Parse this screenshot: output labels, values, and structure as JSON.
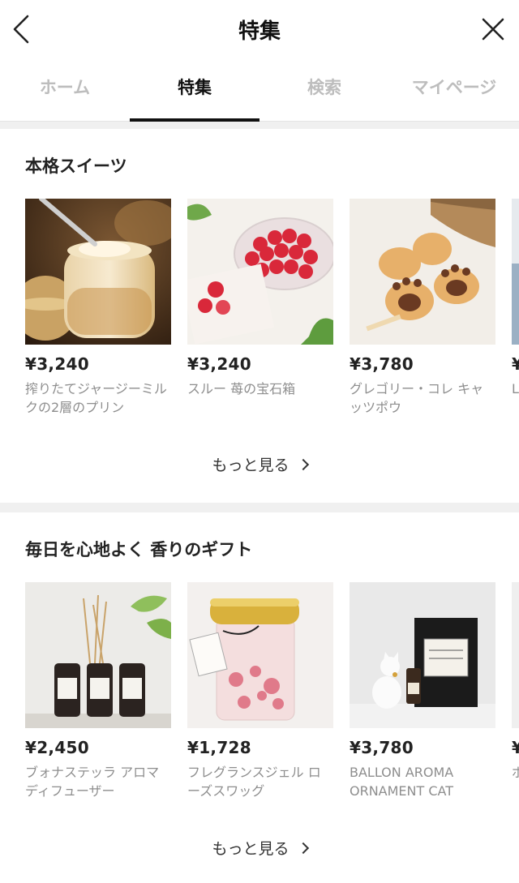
{
  "header": {
    "title": "特集",
    "back_icon": "chevron-left-icon",
    "close_icon": "close-icon"
  },
  "tabs": [
    {
      "label": "ホーム",
      "active": false
    },
    {
      "label": "特集",
      "active": true
    },
    {
      "label": "検索",
      "active": false
    },
    {
      "label": "マイページ",
      "active": false
    }
  ],
  "sections": [
    {
      "title": "本格スイーツ",
      "more_label": "もっと見る",
      "products": [
        {
          "price": "¥3,240",
          "name": "搾りたてジャージーミルクの2層のプリン"
        },
        {
          "price": "¥3,240",
          "name": "スルー 苺の宝石箱"
        },
        {
          "price": "¥3,780",
          "name": "グレゴリー・コレ キャッツポウ"
        },
        {
          "price": "¥",
          "name": "L一"
        }
      ]
    },
    {
      "title": "毎日を心地よく 香りのギフト",
      "more_label": "もっと見る",
      "products": [
        {
          "price": "¥2,450",
          "name": "ブォナステッラ アロマディフューザー"
        },
        {
          "price": "¥1,728",
          "name": "フレグランスジェル ローズスワッグ"
        },
        {
          "price": "¥3,780",
          "name": "BALLON AROMA ORNAMENT CAT"
        },
        {
          "price": "¥",
          "name": "ボ"
        }
      ]
    }
  ]
}
